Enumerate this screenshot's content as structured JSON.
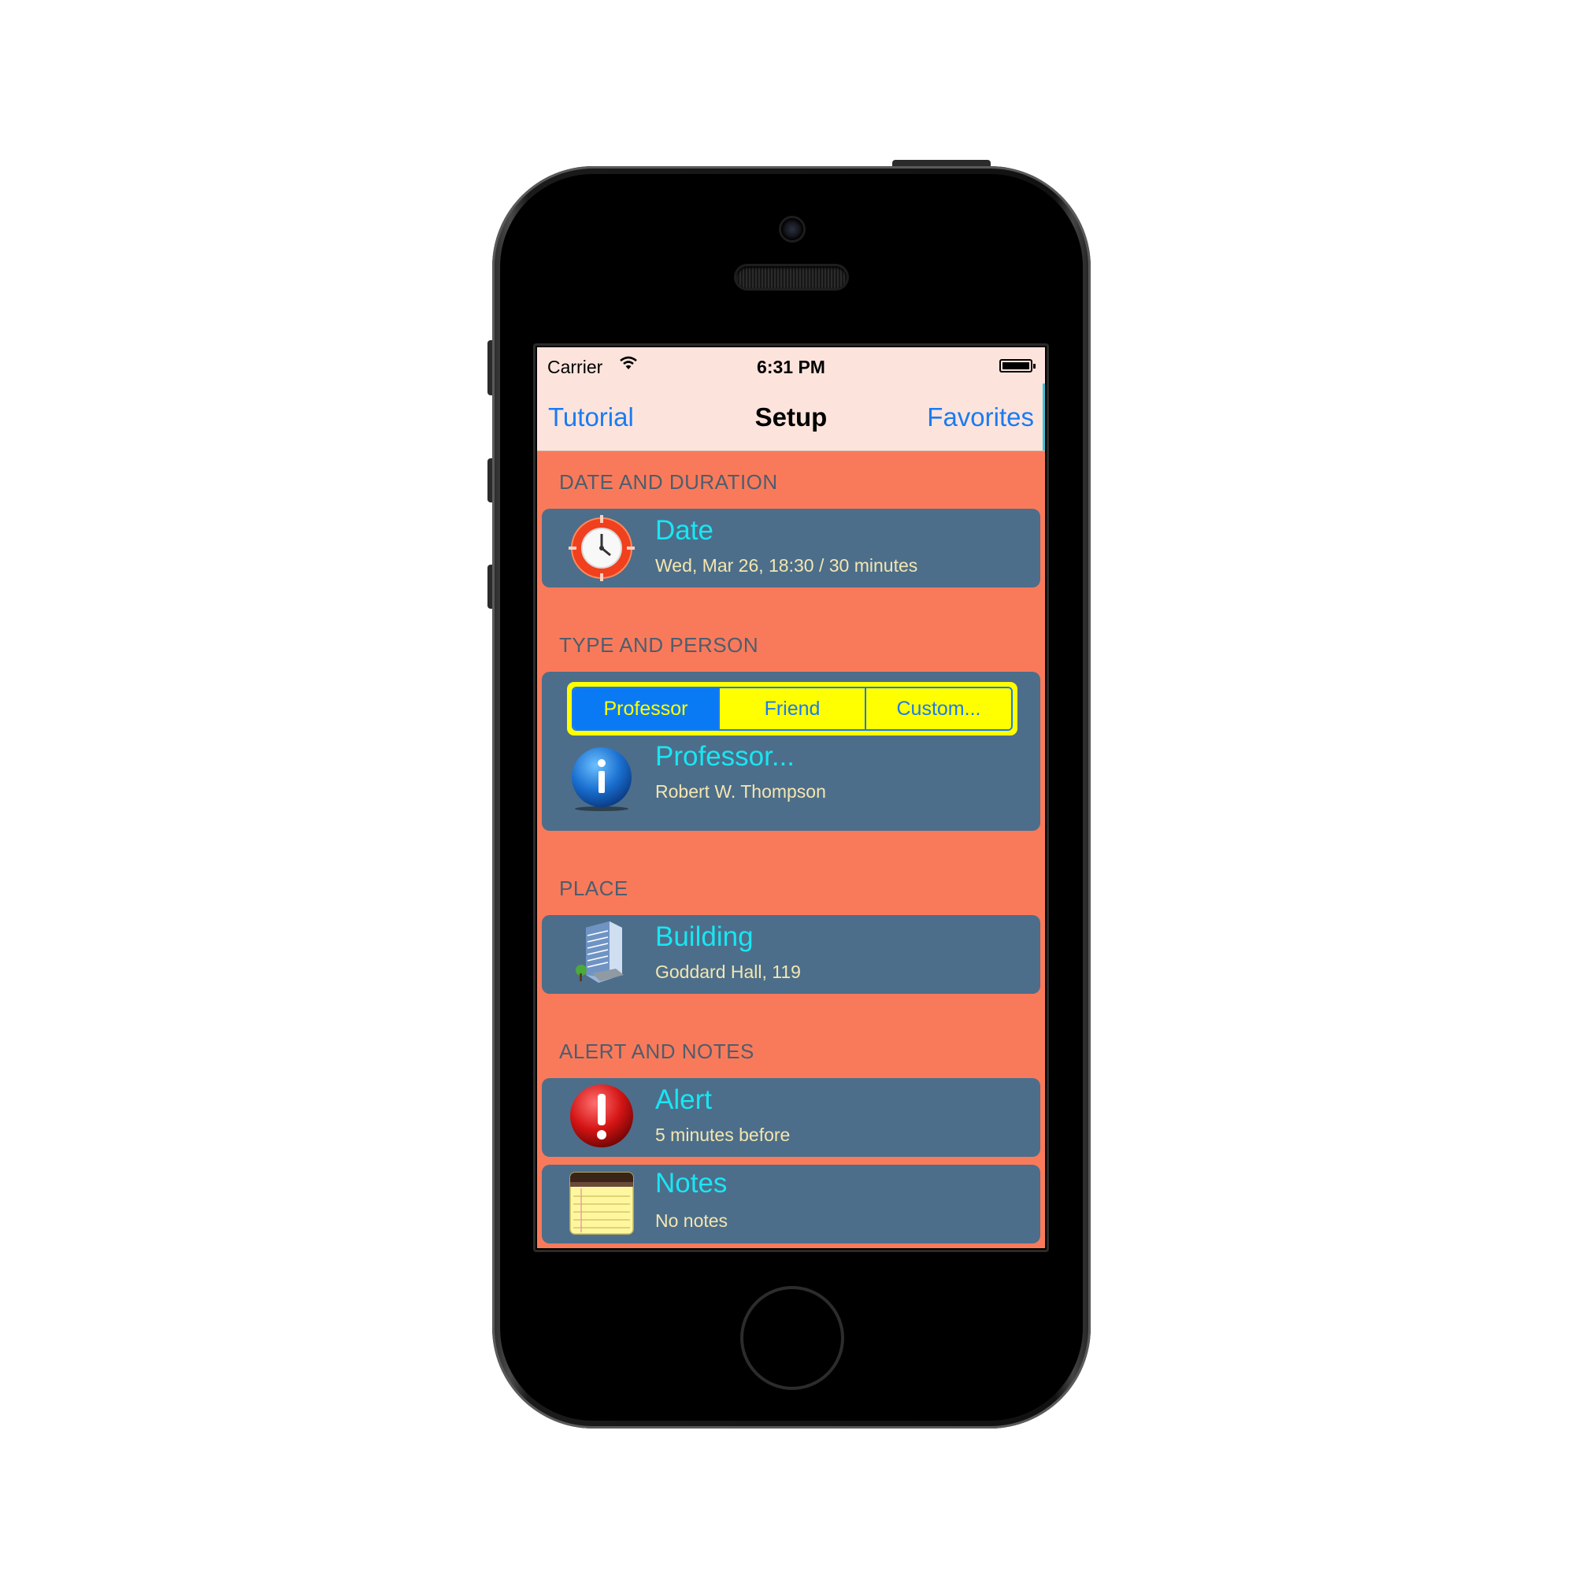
{
  "status_bar": {
    "carrier": "Carrier",
    "time": "6:31 PM"
  },
  "nav": {
    "left": "Tutorial",
    "title": "Setup",
    "right": "Favorites"
  },
  "sections": {
    "date": {
      "header": "DATE AND DURATION",
      "title": "Date",
      "subtitle": "Wed, Mar 26, 18:30 / 30 minutes",
      "icon": "clock-icon"
    },
    "type": {
      "header": "TYPE AND PERSON",
      "segments": [
        "Professor",
        "Friend",
        "Custom..."
      ],
      "selected_segment": "Professor",
      "title": "Professor...",
      "subtitle": "Robert W. Thompson",
      "icon": "info-icon"
    },
    "place": {
      "header": "PLACE",
      "title": "Building",
      "subtitle": "Goddard Hall, 119",
      "icon": "building-icon"
    },
    "alert": {
      "header": "ALERT AND NOTES",
      "alert_title": "Alert",
      "alert_subtitle": "5 minutes before",
      "alert_icon": "alert-icon",
      "notes_title": "Notes",
      "notes_subtitle": "No notes",
      "notes_icon": "notepad-icon"
    }
  },
  "colors": {
    "background": "#f97a5a",
    "bar": "#fce4dc",
    "cell": "#4c6e8a",
    "cell_title": "#19e6f2",
    "cell_subtitle": "#f4e6b0",
    "accent": "#1a7bf2",
    "segment_fill": "#ffff00"
  }
}
